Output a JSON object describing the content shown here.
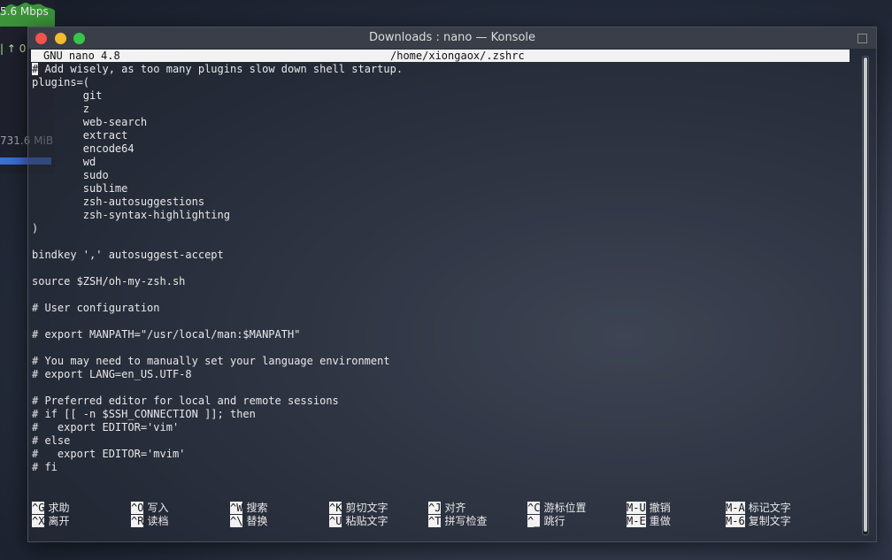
{
  "widget": {
    "speed": "5.6 Mbps",
    "up": "| ↑ 0",
    "memory": "731.6 MiB",
    "memory_fill": 1.0
  },
  "window": {
    "title": "Downloads : nano — Konsole"
  },
  "nano": {
    "version": "GNU nano 4.8",
    "file": "/home/xiongaox/.zshrc",
    "cursor_char": "#",
    "first_line_rest": " Add wisely, as too many plugins slow down shell startup.",
    "lines": [
      "plugins=(",
      "        git",
      "        z",
      "        web-search",
      "        extract",
      "        encode64",
      "        wd",
      "        sudo",
      "        sublime",
      "        zsh-autosuggestions",
      "        zsh-syntax-highlighting",
      ")",
      "",
      "bindkey ',' autosuggest-accept",
      "",
      "source $ZSH/oh-my-zsh.sh",
      "",
      "# User configuration",
      "",
      "# export MANPATH=\"/usr/local/man:$MANPATH\"",
      "",
      "# You may need to manually set your language environment",
      "# export LANG=en_US.UTF-8",
      "",
      "# Preferred editor for local and remote sessions",
      "# if [[ -n $SSH_CONNECTION ]]; then",
      "#   export EDITOR='vim'",
      "# else",
      "#   export EDITOR='mvim'",
      "# fi"
    ],
    "shortcuts_row1": [
      {
        "key": "^G",
        "label": "求助"
      },
      {
        "key": "^O",
        "label": "写入"
      },
      {
        "key": "^W",
        "label": "搜索"
      },
      {
        "key": "^K",
        "label": "剪切文字"
      },
      {
        "key": "^J",
        "label": "对齐"
      },
      {
        "key": "^C",
        "label": "游标位置"
      },
      {
        "key": "M-U",
        "label": "撤销"
      },
      {
        "key": "M-A",
        "label": "标记文字"
      }
    ],
    "shortcuts_row2": [
      {
        "key": "^X",
        "label": "离开"
      },
      {
        "key": "^R",
        "label": "读档"
      },
      {
        "key": "^\\",
        "label": "替换"
      },
      {
        "key": "^U",
        "label": "粘贴文字"
      },
      {
        "key": "^T",
        "label": "拼写检查"
      },
      {
        "key": "^_",
        "label": "跳行"
      },
      {
        "key": "M-E",
        "label": "重做"
      },
      {
        "key": "M-6",
        "label": "复制文字"
      }
    ]
  }
}
